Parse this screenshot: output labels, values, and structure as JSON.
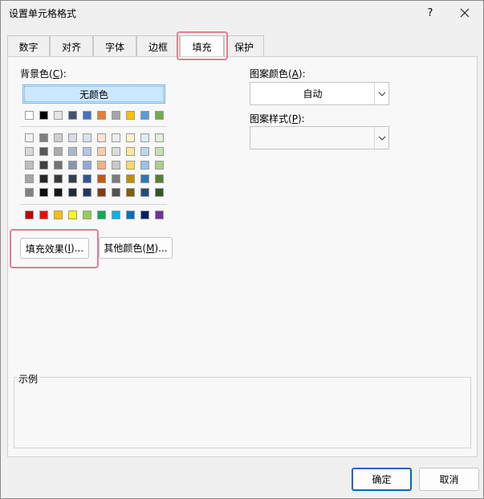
{
  "window": {
    "title": "设置单元格格式",
    "help_label": "?",
    "close_icon": "close-icon"
  },
  "tabs": [
    {
      "label": "数字",
      "active": false
    },
    {
      "label": "对齐",
      "active": false
    },
    {
      "label": "字体",
      "active": false
    },
    {
      "label": "边框",
      "active": false
    },
    {
      "label": "填充",
      "active": true
    },
    {
      "label": "保护",
      "active": false
    }
  ],
  "fill": {
    "bg_label": "背景色",
    "bg_hotkey": "C",
    "no_color_label": "无颜色",
    "theme_row": [
      "#ffffff",
      "#000000",
      "#e7e6e6",
      "#44546a",
      "#4472c4",
      "#ed7d31",
      "#a5a5a5",
      "#ffc000",
      "#5b9bd5",
      "#70ad47"
    ],
    "tint_rows": [
      [
        "#f2f2f2",
        "#7f7f7f",
        "#d0cece",
        "#d6dce4",
        "#d9e1f2",
        "#fce4d6",
        "#ededed",
        "#fff2cc",
        "#ddebf7",
        "#e2efda"
      ],
      [
        "#d9d9d9",
        "#595959",
        "#aeaaaa",
        "#acb9ca",
        "#b4c6e7",
        "#f8cbad",
        "#dbdbdb",
        "#ffe699",
        "#bdd7ee",
        "#c6e0b4"
      ],
      [
        "#bfbfbf",
        "#404040",
        "#757171",
        "#8497b0",
        "#8ea9db",
        "#f4b084",
        "#c9c9c9",
        "#ffd966",
        "#9bc2e6",
        "#a9d08e"
      ],
      [
        "#a6a6a6",
        "#262626",
        "#3a3838",
        "#333f4f",
        "#2f5597",
        "#c65911",
        "#7b7b7b",
        "#bf8f00",
        "#2e75b6",
        "#548235"
      ],
      [
        "#808080",
        "#0d0d0d",
        "#161616",
        "#222b35",
        "#203764",
        "#833c0c",
        "#525252",
        "#806000",
        "#1f4e78",
        "#375623"
      ]
    ],
    "standard_row": [
      "#c00000",
      "#ff0000",
      "#ffc000",
      "#ffff00",
      "#92d050",
      "#00b050",
      "#00b0f0",
      "#0070c0",
      "#002060",
      "#7030a0"
    ],
    "fill_effects_label": "填充效果",
    "fill_effects_hotkey": "I",
    "more_colors_label": "其他颜色",
    "more_colors_hotkey": "M",
    "ellipsis": "...",
    "pattern_color_label": "图案颜色",
    "pattern_color_hotkey": "A",
    "pattern_color_value": "自动",
    "pattern_style_label": "图案样式",
    "pattern_style_hotkey": "P",
    "pattern_style_value": "",
    "sample_label": "示例"
  },
  "footer": {
    "ok_label": "确定",
    "cancel_label": "取消"
  }
}
